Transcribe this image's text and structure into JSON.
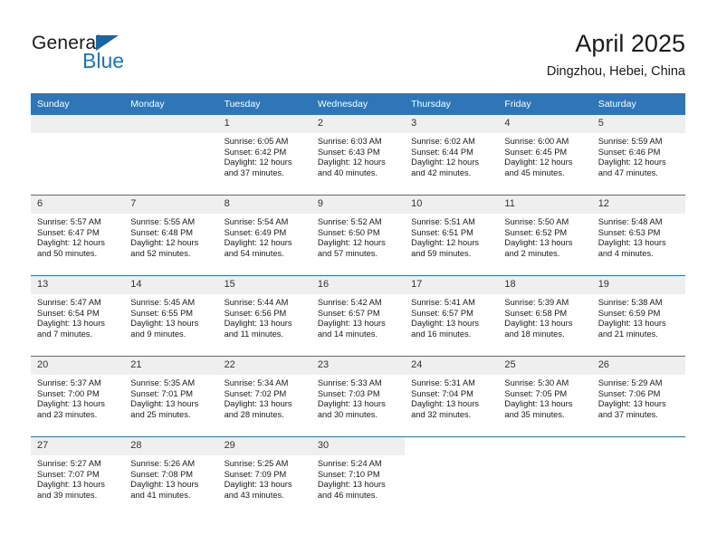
{
  "brand": {
    "name_part1": "General",
    "name_part2": "Blue",
    "triangle_icon": "triangle-icon",
    "accent_color": "#1477c4",
    "triangle_color": "#1565a8"
  },
  "header": {
    "title": "April 2025",
    "location": "Dingzhou, Hebei, China"
  },
  "calendar": {
    "header_bg": "#2f76b8",
    "daynum_band_bg": "#efefef",
    "weekday_headers": [
      "Sunday",
      "Monday",
      "Tuesday",
      "Wednesday",
      "Thursday",
      "Friday",
      "Saturday"
    ],
    "weeks": [
      [
        {
          "day": "",
          "empty": true,
          "sunrise": "",
          "sunset": "",
          "daylight_line1": "",
          "daylight_line2": ""
        },
        {
          "day": "",
          "empty": true,
          "sunrise": "",
          "sunset": "",
          "daylight_line1": "",
          "daylight_line2": ""
        },
        {
          "day": "1",
          "sunrise": "Sunrise: 6:05 AM",
          "sunset": "Sunset: 6:42 PM",
          "daylight_line1": "Daylight: 12 hours",
          "daylight_line2": "and 37 minutes."
        },
        {
          "day": "2",
          "sunrise": "Sunrise: 6:03 AM",
          "sunset": "Sunset: 6:43 PM",
          "daylight_line1": "Daylight: 12 hours",
          "daylight_line2": "and 40 minutes."
        },
        {
          "day": "3",
          "sunrise": "Sunrise: 6:02 AM",
          "sunset": "Sunset: 6:44 PM",
          "daylight_line1": "Daylight: 12 hours",
          "daylight_line2": "and 42 minutes."
        },
        {
          "day": "4",
          "sunrise": "Sunrise: 6:00 AM",
          "sunset": "Sunset: 6:45 PM",
          "daylight_line1": "Daylight: 12 hours",
          "daylight_line2": "and 45 minutes."
        },
        {
          "day": "5",
          "sunrise": "Sunrise: 5:59 AM",
          "sunset": "Sunset: 6:46 PM",
          "daylight_line1": "Daylight: 12 hours",
          "daylight_line2": "and 47 minutes."
        }
      ],
      [
        {
          "day": "6",
          "sunrise": "Sunrise: 5:57 AM",
          "sunset": "Sunset: 6:47 PM",
          "daylight_line1": "Daylight: 12 hours",
          "daylight_line2": "and 50 minutes."
        },
        {
          "day": "7",
          "sunrise": "Sunrise: 5:55 AM",
          "sunset": "Sunset: 6:48 PM",
          "daylight_line1": "Daylight: 12 hours",
          "daylight_line2": "and 52 minutes."
        },
        {
          "day": "8",
          "sunrise": "Sunrise: 5:54 AM",
          "sunset": "Sunset: 6:49 PM",
          "daylight_line1": "Daylight: 12 hours",
          "daylight_line2": "and 54 minutes."
        },
        {
          "day": "9",
          "sunrise": "Sunrise: 5:52 AM",
          "sunset": "Sunset: 6:50 PM",
          "daylight_line1": "Daylight: 12 hours",
          "daylight_line2": "and 57 minutes."
        },
        {
          "day": "10",
          "sunrise": "Sunrise: 5:51 AM",
          "sunset": "Sunset: 6:51 PM",
          "daylight_line1": "Daylight: 12 hours",
          "daylight_line2": "and 59 minutes."
        },
        {
          "day": "11",
          "sunrise": "Sunrise: 5:50 AM",
          "sunset": "Sunset: 6:52 PM",
          "daylight_line1": "Daylight: 13 hours",
          "daylight_line2": "and 2 minutes."
        },
        {
          "day": "12",
          "sunrise": "Sunrise: 5:48 AM",
          "sunset": "Sunset: 6:53 PM",
          "daylight_line1": "Daylight: 13 hours",
          "daylight_line2": "and 4 minutes."
        }
      ],
      [
        {
          "day": "13",
          "sunrise": "Sunrise: 5:47 AM",
          "sunset": "Sunset: 6:54 PM",
          "daylight_line1": "Daylight: 13 hours",
          "daylight_line2": "and 7 minutes."
        },
        {
          "day": "14",
          "sunrise": "Sunrise: 5:45 AM",
          "sunset": "Sunset: 6:55 PM",
          "daylight_line1": "Daylight: 13 hours",
          "daylight_line2": "and 9 minutes."
        },
        {
          "day": "15",
          "sunrise": "Sunrise: 5:44 AM",
          "sunset": "Sunset: 6:56 PM",
          "daylight_line1": "Daylight: 13 hours",
          "daylight_line2": "and 11 minutes."
        },
        {
          "day": "16",
          "sunrise": "Sunrise: 5:42 AM",
          "sunset": "Sunset: 6:57 PM",
          "daylight_line1": "Daylight: 13 hours",
          "daylight_line2": "and 14 minutes."
        },
        {
          "day": "17",
          "sunrise": "Sunrise: 5:41 AM",
          "sunset": "Sunset: 6:57 PM",
          "daylight_line1": "Daylight: 13 hours",
          "daylight_line2": "and 16 minutes."
        },
        {
          "day": "18",
          "sunrise": "Sunrise: 5:39 AM",
          "sunset": "Sunset: 6:58 PM",
          "daylight_line1": "Daylight: 13 hours",
          "daylight_line2": "and 18 minutes."
        },
        {
          "day": "19",
          "sunrise": "Sunrise: 5:38 AM",
          "sunset": "Sunset: 6:59 PM",
          "daylight_line1": "Daylight: 13 hours",
          "daylight_line2": "and 21 minutes."
        }
      ],
      [
        {
          "day": "20",
          "sunrise": "Sunrise: 5:37 AM",
          "sunset": "Sunset: 7:00 PM",
          "daylight_line1": "Daylight: 13 hours",
          "daylight_line2": "and 23 minutes."
        },
        {
          "day": "21",
          "sunrise": "Sunrise: 5:35 AM",
          "sunset": "Sunset: 7:01 PM",
          "daylight_line1": "Daylight: 13 hours",
          "daylight_line2": "and 25 minutes."
        },
        {
          "day": "22",
          "sunrise": "Sunrise: 5:34 AM",
          "sunset": "Sunset: 7:02 PM",
          "daylight_line1": "Daylight: 13 hours",
          "daylight_line2": "and 28 minutes."
        },
        {
          "day": "23",
          "sunrise": "Sunrise: 5:33 AM",
          "sunset": "Sunset: 7:03 PM",
          "daylight_line1": "Daylight: 13 hours",
          "daylight_line2": "and 30 minutes."
        },
        {
          "day": "24",
          "sunrise": "Sunrise: 5:31 AM",
          "sunset": "Sunset: 7:04 PM",
          "daylight_line1": "Daylight: 13 hours",
          "daylight_line2": "and 32 minutes."
        },
        {
          "day": "25",
          "sunrise": "Sunrise: 5:30 AM",
          "sunset": "Sunset: 7:05 PM",
          "daylight_line1": "Daylight: 13 hours",
          "daylight_line2": "and 35 minutes."
        },
        {
          "day": "26",
          "sunrise": "Sunrise: 5:29 AM",
          "sunset": "Sunset: 7:06 PM",
          "daylight_line1": "Daylight: 13 hours",
          "daylight_line2": "and 37 minutes."
        }
      ],
      [
        {
          "day": "27",
          "sunrise": "Sunrise: 5:27 AM",
          "sunset": "Sunset: 7:07 PM",
          "daylight_line1": "Daylight: 13 hours",
          "daylight_line2": "and 39 minutes."
        },
        {
          "day": "28",
          "sunrise": "Sunrise: 5:26 AM",
          "sunset": "Sunset: 7:08 PM",
          "daylight_line1": "Daylight: 13 hours",
          "daylight_line2": "and 41 minutes."
        },
        {
          "day": "29",
          "sunrise": "Sunrise: 5:25 AM",
          "sunset": "Sunset: 7:09 PM",
          "daylight_line1": "Daylight: 13 hours",
          "daylight_line2": "and 43 minutes."
        },
        {
          "day": "30",
          "sunrise": "Sunrise: 5:24 AM",
          "sunset": "Sunset: 7:10 PM",
          "daylight_line1": "Daylight: 13 hours",
          "daylight_line2": "and 46 minutes."
        },
        {
          "day": "",
          "trailing": true,
          "sunrise": "",
          "sunset": "",
          "daylight_line1": "",
          "daylight_line2": ""
        },
        {
          "day": "",
          "trailing": true,
          "sunrise": "",
          "sunset": "",
          "daylight_line1": "",
          "daylight_line2": ""
        },
        {
          "day": "",
          "trailing": true,
          "sunrise": "",
          "sunset": "",
          "daylight_line1": "",
          "daylight_line2": ""
        }
      ]
    ]
  }
}
